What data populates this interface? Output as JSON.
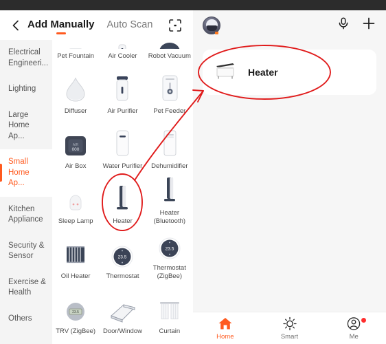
{
  "app": {
    "left_screen": {
      "header": {
        "back_icon": "chevron-left-icon",
        "tab_add_manually": "Add Manually",
        "tab_auto_scan": "Auto Scan",
        "scan_icon": "scan-frame-icon"
      },
      "sidebar": {
        "items": [
          {
            "label": "Electrical Engineeri...",
            "active": false
          },
          {
            "label": "Lighting",
            "active": false
          },
          {
            "label": "Large Home Ap...",
            "active": false
          },
          {
            "label": "Small Home Ap...",
            "active": true
          },
          {
            "label": "Kitchen Appliance",
            "active": false
          },
          {
            "label": "Security & Sensor",
            "active": false
          },
          {
            "label": "Exercise & Health",
            "active": false
          },
          {
            "label": "Others",
            "active": false
          }
        ]
      },
      "grid": {
        "items": [
          {
            "label": "Pet Fountain",
            "icon": "pet-fountain-icon",
            "clipped": true
          },
          {
            "label": "Air Cooler",
            "icon": "air-cooler-icon",
            "clipped": true
          },
          {
            "label": "Robot Vacuum",
            "icon": "robot-vacuum-icon",
            "clipped": true
          },
          {
            "label": "Diffuser",
            "icon": "diffuser-icon",
            "clipped": false
          },
          {
            "label": "Air Purifier",
            "icon": "air-purifier-icon",
            "clipped": false
          },
          {
            "label": "Pet Feeder",
            "icon": "pet-feeder-icon",
            "clipped": false
          },
          {
            "label": "Air Box",
            "icon": "air-box-icon",
            "clipped": false
          },
          {
            "label": "Water Purifier",
            "icon": "water-purifier-icon",
            "clipped": false
          },
          {
            "label": "Dehumidifier",
            "icon": "dehumidifier-icon",
            "clipped": false
          },
          {
            "label": "Sleep Lamp",
            "icon": "sleep-lamp-icon",
            "clipped": false
          },
          {
            "label": "Heater",
            "icon": "heater-icon",
            "clipped": false
          },
          {
            "label": "Heater (Bluetooth)",
            "icon": "heater-bluetooth-icon",
            "clipped": false
          },
          {
            "label": "Oil Heater",
            "icon": "oil-heater-icon",
            "clipped": false
          },
          {
            "label": "Thermostat",
            "icon": "thermostat-icon",
            "clipped": false
          },
          {
            "label": "Thermostat (ZigBee)",
            "icon": "thermostat-zigbee-icon",
            "clipped": false
          },
          {
            "label": "TRV (ZigBee)",
            "icon": "trv-zigbee-icon",
            "clipped": false
          },
          {
            "label": "Door/Window",
            "icon": "door-window-icon",
            "clipped": false
          },
          {
            "label": "Curtain",
            "icon": "curtain-icon",
            "clipped": false
          }
        ],
        "thermostat_temp": "23.5"
      }
    },
    "right_screen": {
      "header": {
        "avatar": "user-avatar",
        "mic_icon": "microphone-icon",
        "add_icon": "plus-icon"
      },
      "device_card": {
        "name": "Heater",
        "icon": "heater-device-icon"
      },
      "bottom_nav": [
        {
          "label": "Home",
          "icon": "home-icon",
          "active": true,
          "badge": false
        },
        {
          "label": "Smart",
          "icon": "sun-icon",
          "active": false,
          "badge": false
        },
        {
          "label": "Me",
          "icon": "person-circle-icon",
          "active": false,
          "badge": true
        }
      ]
    },
    "colors": {
      "accent": "#ff5a1f",
      "annotation": "#e01b1b",
      "badge": "#ff2d2d",
      "statusbar": "#2c2c2c"
    }
  }
}
